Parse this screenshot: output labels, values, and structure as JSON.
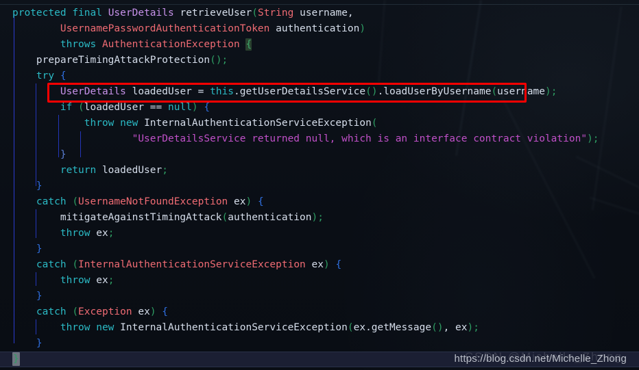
{
  "editor": {
    "language": "java",
    "theme_background": "#0c1018",
    "current_line_background": "#1b1f33",
    "colors": {
      "keyword": "#2bbac5",
      "type_violet": "#c792ea",
      "class_salmon": "#ef6b73",
      "identifier": "#d6deeb",
      "paren_green": "#2e9e63",
      "brace_blue": "#2f6fe0",
      "string_magenta": "#c050c8",
      "annotation_red": "#fe0000",
      "brace_match_bg": "#29412f"
    },
    "lines": [
      {
        "n": 1,
        "indent": 0,
        "tokens": [
          {
            "t": "protected ",
            "c": "kw"
          },
          {
            "t": "final ",
            "c": "kw"
          },
          {
            "t": "UserDetails",
            "c": "type"
          },
          {
            "t": " retrieveUser",
            "c": "plain"
          },
          {
            "t": "(",
            "c": "paren"
          },
          {
            "t": "String",
            "c": "cls"
          },
          {
            "t": " username,",
            "c": "plain"
          }
        ]
      },
      {
        "n": 2,
        "indent": 0,
        "tokens": [
          {
            "t": "        UsernamePasswordAuthenticationToken",
            "c": "cls"
          },
          {
            "t": " authentication",
            "c": "plain"
          },
          {
            "t": ")",
            "c": "paren"
          }
        ]
      },
      {
        "n": 3,
        "indent": 0,
        "tokens": [
          {
            "t": "        throws ",
            "c": "kw"
          },
          {
            "t": "AuthenticationException",
            "c": "cls"
          },
          {
            "t": " ",
            "c": "plain"
          },
          {
            "t": "{",
            "c": "bmatch"
          }
        ]
      },
      {
        "n": 4,
        "indent": 0,
        "tokens": [
          {
            "t": "    prepareTimingAttackProtection",
            "c": "plain"
          },
          {
            "t": "();",
            "c": "paren"
          }
        ]
      },
      {
        "n": 5,
        "indent": 0,
        "tokens": [
          {
            "t": "    try ",
            "c": "kw"
          },
          {
            "t": "{",
            "c": "brace"
          }
        ]
      },
      {
        "n": 6,
        "indent": 0,
        "highlighted": true,
        "tokens": [
          {
            "t": "        UserDetails",
            "c": "type"
          },
          {
            "t": " loadedUser ",
            "c": "plain"
          },
          {
            "t": "= ",
            "c": "op"
          },
          {
            "t": "this",
            "c": "kw"
          },
          {
            "t": ".getUserDetailsService",
            "c": "plain"
          },
          {
            "t": "()",
            "c": "paren"
          },
          {
            "t": ".loadUserByUsername",
            "c": "plain"
          },
          {
            "t": "(",
            "c": "paren"
          },
          {
            "t": "username",
            "c": "plain"
          },
          {
            "t": ");",
            "c": "paren"
          }
        ]
      },
      {
        "n": 7,
        "indent": 0,
        "tokens": [
          {
            "t": "        if ",
            "c": "kw"
          },
          {
            "t": "(",
            "c": "paren"
          },
          {
            "t": "loadedUser ",
            "c": "plain"
          },
          {
            "t": "== ",
            "c": "op"
          },
          {
            "t": "null",
            "c": "kw"
          },
          {
            "t": ")",
            "c": "paren"
          },
          {
            "t": " ",
            "c": "plain"
          },
          {
            "t": "{",
            "c": "brace"
          }
        ]
      },
      {
        "n": 8,
        "indent": 0,
        "tokens": [
          {
            "t": "            throw ",
            "c": "kw"
          },
          {
            "t": "new ",
            "c": "kw"
          },
          {
            "t": "InternalAuthenticationServiceException",
            "c": "plain"
          },
          {
            "t": "(",
            "c": "paren"
          }
        ]
      },
      {
        "n": 9,
        "indent": 0,
        "tokens": [
          {
            "t": "                    \"UserDetailsService returned null, which is an interface contract violation\"",
            "c": "str"
          },
          {
            "t": ")",
            "c": "paren"
          },
          {
            "t": ";",
            "c": "paren"
          }
        ]
      },
      {
        "n": 10,
        "indent": 0,
        "tokens": [
          {
            "t": "        }",
            "c": "brace2"
          }
        ]
      },
      {
        "n": 11,
        "indent": 0,
        "tokens": [
          {
            "t": "        return ",
            "c": "kw"
          },
          {
            "t": "loadedUser",
            "c": "plain"
          },
          {
            "t": ";",
            "c": "paren"
          }
        ]
      },
      {
        "n": 12,
        "indent": 0,
        "tokens": [
          {
            "t": "    }",
            "c": "brace"
          }
        ]
      },
      {
        "n": 13,
        "indent": 0,
        "tokens": [
          {
            "t": "    catch ",
            "c": "kw"
          },
          {
            "t": "(",
            "c": "paren"
          },
          {
            "t": "UsernameNotFoundException",
            "c": "cls"
          },
          {
            "t": " ex",
            "c": "plain"
          },
          {
            "t": ")",
            "c": "paren"
          },
          {
            "t": " ",
            "c": "plain"
          },
          {
            "t": "{",
            "c": "brace"
          }
        ]
      },
      {
        "n": 14,
        "indent": 0,
        "tokens": [
          {
            "t": "        mitigateAgainstTimingAttack",
            "c": "plain"
          },
          {
            "t": "(",
            "c": "paren"
          },
          {
            "t": "authentication",
            "c": "plain"
          },
          {
            "t": ");",
            "c": "paren"
          }
        ]
      },
      {
        "n": 15,
        "indent": 0,
        "tokens": [
          {
            "t": "        throw ",
            "c": "kw"
          },
          {
            "t": "ex",
            "c": "plain"
          },
          {
            "t": ";",
            "c": "paren"
          }
        ]
      },
      {
        "n": 16,
        "indent": 0,
        "tokens": [
          {
            "t": "    }",
            "c": "brace"
          }
        ]
      },
      {
        "n": 17,
        "indent": 0,
        "tokens": [
          {
            "t": "    catch ",
            "c": "kw"
          },
          {
            "t": "(",
            "c": "paren"
          },
          {
            "t": "InternalAuthenticationServiceException",
            "c": "cls"
          },
          {
            "t": " ex",
            "c": "plain"
          },
          {
            "t": ")",
            "c": "paren"
          },
          {
            "t": " ",
            "c": "plain"
          },
          {
            "t": "{",
            "c": "brace"
          }
        ]
      },
      {
        "n": 18,
        "indent": 0,
        "tokens": [
          {
            "t": "        throw ",
            "c": "kw"
          },
          {
            "t": "ex",
            "c": "plain"
          },
          {
            "t": ";",
            "c": "paren"
          }
        ]
      },
      {
        "n": 19,
        "indent": 0,
        "tokens": [
          {
            "t": "    }",
            "c": "brace"
          }
        ]
      },
      {
        "n": 20,
        "indent": 0,
        "tokens": [
          {
            "t": "    catch ",
            "c": "kw"
          },
          {
            "t": "(",
            "c": "paren"
          },
          {
            "t": "Exception",
            "c": "cls"
          },
          {
            "t": " ex",
            "c": "plain"
          },
          {
            "t": ")",
            "c": "paren"
          },
          {
            "t": " ",
            "c": "plain"
          },
          {
            "t": "{",
            "c": "brace"
          }
        ]
      },
      {
        "n": 21,
        "indent": 0,
        "tokens": [
          {
            "t": "        throw ",
            "c": "kw"
          },
          {
            "t": "new ",
            "c": "kw"
          },
          {
            "t": "InternalAuthenticationServiceException",
            "c": "plain"
          },
          {
            "t": "(",
            "c": "paren"
          },
          {
            "t": "ex",
            "c": "plain"
          },
          {
            "t": ".getMessage",
            "c": "plain"
          },
          {
            "t": "()",
            "c": "paren"
          },
          {
            "t": ", ",
            "c": "op"
          },
          {
            "t": "ex",
            "c": "plain"
          },
          {
            "t": ");",
            "c": "paren"
          }
        ]
      },
      {
        "n": 22,
        "indent": 0,
        "tokens": [
          {
            "t": "    }",
            "c": "brace"
          }
        ]
      },
      {
        "n": 23,
        "indent": 0,
        "current": true,
        "tokens": [
          {
            "t": "}",
            "c": "bmatch-sel"
          }
        ]
      }
    ]
  },
  "annotation": {
    "type": "rectangle",
    "color": "#fe0000",
    "target_line": 6,
    "target_text": "UserDetails loadedUser = this.getUserDetailsService().loadUserByUsername(username);"
  },
  "watermark": {
    "url": "https://blog.csdn.net/Michelle_Zhong",
    "logo_text": "CSDN @Michelle_Zhong"
  }
}
